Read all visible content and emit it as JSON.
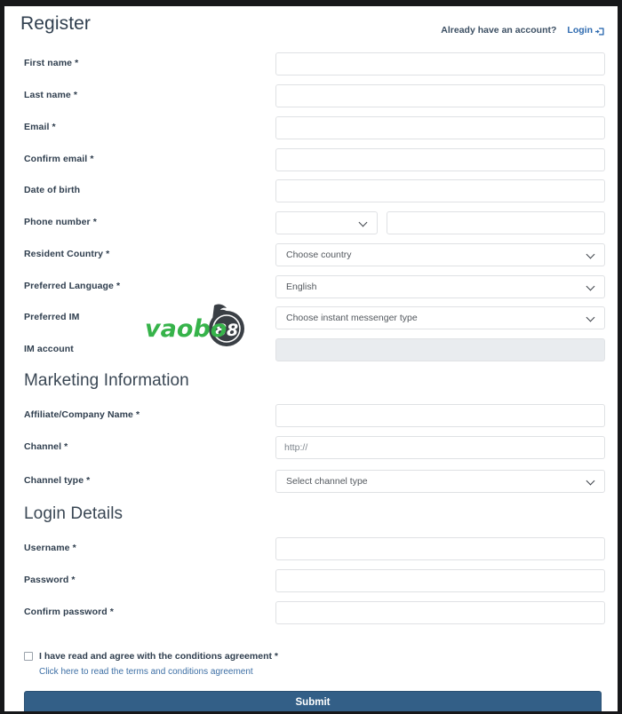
{
  "header": {
    "title": "Register",
    "account_note": "Already have an account?",
    "login_label": "Login",
    "login_icon": "sign-in-icon"
  },
  "watermark": {
    "text": "vaobo",
    "badge": "88",
    "green": "#36b34a",
    "dark": "#3a3f45"
  },
  "colors": {
    "label": "#2f3e4e",
    "link": "#3d6fa5",
    "submit_bg": "#335f87",
    "border": "#dfe1e4",
    "disabled_bg": "#e9ecef"
  },
  "personal": {
    "fields": [
      {
        "label": "First name *",
        "value": "",
        "placeholder": "",
        "type": "text"
      },
      {
        "label": "Last name *",
        "value": "",
        "placeholder": "",
        "type": "text"
      },
      {
        "label": "Email *",
        "value": "",
        "placeholder": "",
        "type": "text"
      },
      {
        "label": "Confirm email *",
        "value": "",
        "placeholder": "",
        "type": "text"
      },
      {
        "label": "Date of birth",
        "value": "",
        "placeholder": "",
        "type": "text"
      }
    ],
    "phone": {
      "label": "Phone number *",
      "code_value": "",
      "number_value": "",
      "number_placeholder": ""
    },
    "country": {
      "label": "Resident Country *",
      "selected": "Choose country"
    },
    "language": {
      "label": "Preferred Language *",
      "selected": "English"
    },
    "preferred_im": {
      "label": "Preferred IM",
      "selected": "Choose instant messenger type"
    },
    "im_account": {
      "label": "IM account",
      "value": "",
      "placeholder": ""
    }
  },
  "marketing": {
    "heading": "Marketing Information",
    "affiliate": {
      "label": "Affiliate/Company Name *",
      "value": "",
      "placeholder": ""
    },
    "channel": {
      "label": "Channel *",
      "value": "",
      "placeholder": "http://"
    },
    "channel_type": {
      "label": "Channel type *",
      "selected": "Select channel type"
    }
  },
  "login_details": {
    "heading": "Login Details",
    "username": {
      "label": "Username *",
      "value": "",
      "placeholder": ""
    },
    "password": {
      "label": "Password *",
      "value": "",
      "placeholder": ""
    },
    "confirm_password": {
      "label": "Confirm password *",
      "value": "",
      "placeholder": ""
    }
  },
  "terms": {
    "checkbox_label": "I have read and agree with the conditions agreement *",
    "link_label": "Click here to read the terms and conditions agreement",
    "checked": false
  },
  "submit": {
    "label": "Submit"
  }
}
